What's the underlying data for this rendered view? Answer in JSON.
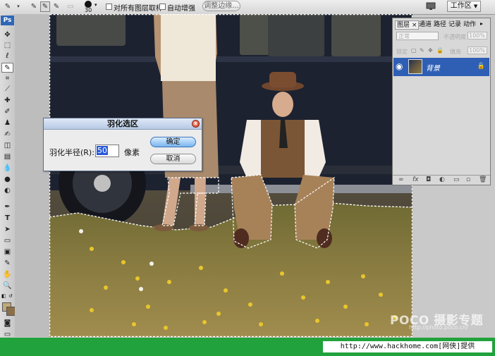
{
  "options_bar": {
    "brush_size": "30",
    "sample_all_layers_label": "对所有图层取样",
    "auto_enhance_label": "自动增强",
    "refine_edge_label": "调整边缘...",
    "workspace_label": "工作区",
    "workspace_arrow": "▼"
  },
  "tools": {
    "ps_logo": "Ps"
  },
  "layers_panel": {
    "tabs": [
      "图层",
      "通道",
      "路径",
      "记录",
      "动作"
    ],
    "tab_close": "×",
    "blend_mode": "正常",
    "opacity_label": "不透明度",
    "opacity_value": "100%",
    "lock_label": "锁定",
    "fill_label": "填充",
    "fill_value": "100%",
    "layer_name": "背景",
    "bottom_icons": [
      "link-icon",
      "fx-icon",
      "mask-icon",
      "adjustment-icon",
      "group-icon",
      "new-layer-icon",
      "trash-icon"
    ]
  },
  "dialog": {
    "title": "羽化选区",
    "radius_label": "羽化半径(R):",
    "radius_value": "50",
    "unit": "像素",
    "ok_label": "确定",
    "cancel_label": "取消"
  },
  "watermark": {
    "brand": "POCO 摄影专题",
    "url": "http://photo.poco.cn/"
  },
  "footer": {
    "text": "http://www.hackhome.com[网侠]提供"
  },
  "colors": {
    "layer_selected": "#2f5fb5",
    "footer_bar": "#21a23c",
    "dialog_ok": "#78b5ef"
  }
}
